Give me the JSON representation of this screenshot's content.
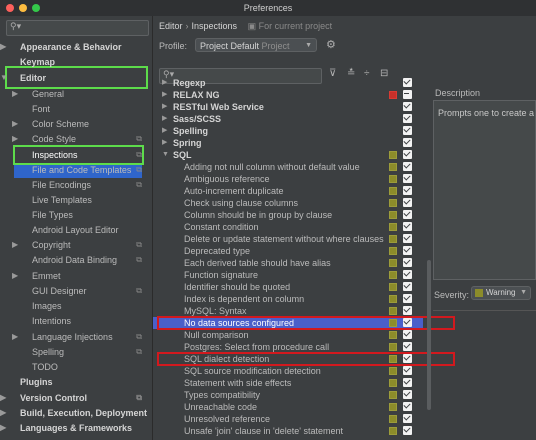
{
  "window": {
    "title": "Preferences"
  },
  "left": {
    "search_icon": "search-icon",
    "items": [
      {
        "label": "Appearance & Behavior",
        "arrow": "▶"
      },
      {
        "label": "Keymap",
        "arrow": ""
      },
      {
        "label": "Editor",
        "arrow": "▼"
      },
      {
        "label": "General",
        "arrow": "▶"
      },
      {
        "label": "Font",
        "arrow": ""
      },
      {
        "label": "Color Scheme",
        "arrow": "▶"
      },
      {
        "label": "Code Style",
        "arrow": "▶"
      },
      {
        "label": "Inspections",
        "arrow": ""
      },
      {
        "label": "File and Code Templates",
        "arrow": ""
      },
      {
        "label": "File Encodings",
        "arrow": ""
      },
      {
        "label": "Live Templates",
        "arrow": ""
      },
      {
        "label": "File Types",
        "arrow": ""
      },
      {
        "label": "Android Layout Editor",
        "arrow": ""
      },
      {
        "label": "Copyright",
        "arrow": "▶"
      },
      {
        "label": "Android Data Binding",
        "arrow": ""
      },
      {
        "label": "Emmet",
        "arrow": "▶"
      },
      {
        "label": "GUI Designer",
        "arrow": ""
      },
      {
        "label": "Images",
        "arrow": ""
      },
      {
        "label": "Intentions",
        "arrow": ""
      },
      {
        "label": "Language Injections",
        "arrow": "▶"
      },
      {
        "label": "Spelling",
        "arrow": ""
      },
      {
        "label": "TODO",
        "arrow": ""
      },
      {
        "label": "Plugins",
        "arrow": ""
      },
      {
        "label": "Version Control",
        "arrow": "▶"
      },
      {
        "label": "Build, Execution, Deployment",
        "arrow": "▶"
      },
      {
        "label": "Languages & Frameworks",
        "arrow": "▶"
      }
    ]
  },
  "header": {
    "crumb_editor": "Editor",
    "crumb_sep": "›",
    "crumb_inspections": "Inspections",
    "crumb_hint": "For current project",
    "profile_label": "Profile:",
    "profile_value": "Project Default",
    "profile_scope": "Project"
  },
  "list": {
    "rows": [
      {
        "label": "Regexp",
        "category": true
      },
      {
        "label": "RELAX NG",
        "category": true
      },
      {
        "label": "RESTful Web Service",
        "category": true
      },
      {
        "label": "Sass/SCSS",
        "category": true
      },
      {
        "label": "Spelling",
        "category": true
      },
      {
        "label": "Spring",
        "category": true
      },
      {
        "label": "SQL",
        "category": true
      },
      {
        "label": "Adding not null column without default value",
        "category": false
      },
      {
        "label": "Ambiguous reference",
        "category": false
      },
      {
        "label": "Auto-increment duplicate",
        "category": false
      },
      {
        "label": "Check using clause columns",
        "category": false
      },
      {
        "label": "Column should be in group by clause",
        "category": false
      },
      {
        "label": "Constant condition",
        "category": false
      },
      {
        "label": "Delete or update statement without where clauses",
        "category": false
      },
      {
        "label": "Deprecated type",
        "category": false
      },
      {
        "label": "Each derived table should have alias",
        "category": false
      },
      {
        "label": "Function signature",
        "category": false
      },
      {
        "label": "Identifier should be quoted",
        "category": false
      },
      {
        "label": "Index is dependent on column",
        "category": false
      },
      {
        "label": "MySQL: Syntax",
        "category": false
      },
      {
        "label": "No data sources configured",
        "category": false
      },
      {
        "label": "Null comparison",
        "category": false
      },
      {
        "label": "Postgres: Select from procedure call",
        "category": false
      },
      {
        "label": "SQL dialect detection",
        "category": false
      },
      {
        "label": "SQL source modification detection",
        "category": false
      },
      {
        "label": "Statement with side effects",
        "category": false
      },
      {
        "label": "Types compatibility",
        "category": false
      },
      {
        "label": "Unreachable code",
        "category": false
      },
      {
        "label": "Unresolved reference",
        "category": false
      },
      {
        "label": "Unsafe 'join' clause in 'delete' statement",
        "category": false
      }
    ]
  },
  "description": {
    "label": "Description",
    "text": "Prompts one to create a"
  },
  "severity": {
    "label": "Severity:",
    "value": "Warning"
  },
  "colors": {
    "selection": "#2f65ca",
    "row_selected": "#4a5fc9",
    "highlight_red": "#d2191e",
    "highlight_green": "#5ddc4b",
    "severity_warning": "#8c8c2a",
    "severity_error": "#c6302a"
  }
}
